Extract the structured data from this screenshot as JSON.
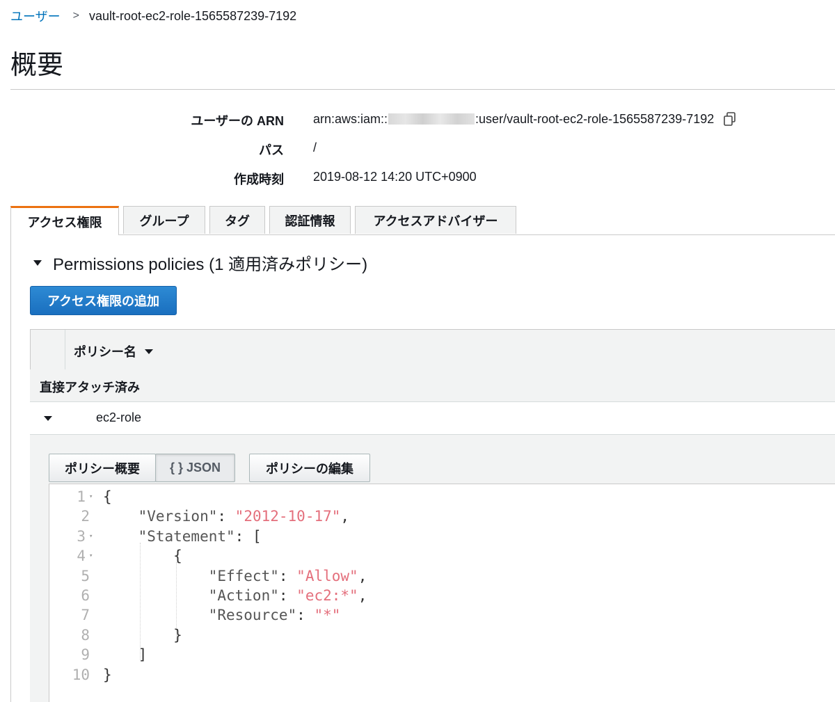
{
  "breadcrumb": {
    "parent": "ユーザー",
    "current": "vault-root-ec2-role-1565587239-7192"
  },
  "page_title": "概要",
  "summary": {
    "arn_label": "ユーザーの ARN",
    "arn_prefix": "arn:aws:iam::",
    "arn_suffix": ":user/vault-root-ec2-role-1565587239-7192",
    "path_label": "パス",
    "path_value": "/",
    "created_label": "作成時刻",
    "created_value": "2019-08-12 14:20 UTC+0900"
  },
  "tabs": [
    {
      "label": "アクセス権限",
      "active": true
    },
    {
      "label": "グループ",
      "active": false
    },
    {
      "label": "タグ",
      "active": false
    },
    {
      "label": "認証情報",
      "active": false
    },
    {
      "label": "アクセスアドバイザー",
      "active": false
    }
  ],
  "permissions": {
    "section_title": "Permissions policies (1 適用済みポリシー)",
    "add_button": "アクセス権限の追加",
    "column_policy_name": "ポリシー名",
    "group_label": "直接アタッチ済み",
    "policy_name": "ec2-role",
    "detail_buttons": {
      "summary": "ポリシー概要",
      "json": "{ } JSON",
      "edit": "ポリシーの編集"
    }
  },
  "json_lines": [
    {
      "n": "1",
      "fold": true,
      "parts": [
        {
          "t": "{",
          "c": "p"
        }
      ]
    },
    {
      "n": "2",
      "fold": false,
      "parts": [
        {
          "t": "    \"Version\"",
          "c": "k"
        },
        {
          "t": ": ",
          "c": "p"
        },
        {
          "t": "\"2012-10-17\"",
          "c": "s"
        },
        {
          "t": ",",
          "c": "p"
        }
      ]
    },
    {
      "n": "3",
      "fold": true,
      "parts": [
        {
          "t": "    \"Statement\"",
          "c": "k"
        },
        {
          "t": ": [",
          "c": "p"
        }
      ]
    },
    {
      "n": "4",
      "fold": true,
      "parts": [
        {
          "t": "        {",
          "c": "p"
        }
      ]
    },
    {
      "n": "5",
      "fold": false,
      "parts": [
        {
          "t": "            \"Effect\"",
          "c": "k"
        },
        {
          "t": ": ",
          "c": "p"
        },
        {
          "t": "\"Allow\"",
          "c": "s"
        },
        {
          "t": ",",
          "c": "p"
        }
      ]
    },
    {
      "n": "6",
      "fold": false,
      "parts": [
        {
          "t": "            \"Action\"",
          "c": "k"
        },
        {
          "t": ": ",
          "c": "p"
        },
        {
          "t": "\"ec2:*\"",
          "c": "s"
        },
        {
          "t": ",",
          "c": "p"
        }
      ]
    },
    {
      "n": "7",
      "fold": false,
      "parts": [
        {
          "t": "            \"Resource\"",
          "c": "k"
        },
        {
          "t": ": ",
          "c": "p"
        },
        {
          "t": "\"*\"",
          "c": "s"
        }
      ]
    },
    {
      "n": "8",
      "fold": false,
      "parts": [
        {
          "t": "        }",
          "c": "p"
        }
      ]
    },
    {
      "n": "9",
      "fold": false,
      "parts": [
        {
          "t": "    ]",
          "c": "p"
        }
      ]
    },
    {
      "n": "10",
      "fold": false,
      "parts": [
        {
          "t": "}",
          "c": "p"
        }
      ]
    }
  ],
  "colors": {
    "accent_tab": "#ec7211",
    "primary_button": "#1a6fbf",
    "link": "#0073bb",
    "json_string": "#e46f7c"
  }
}
